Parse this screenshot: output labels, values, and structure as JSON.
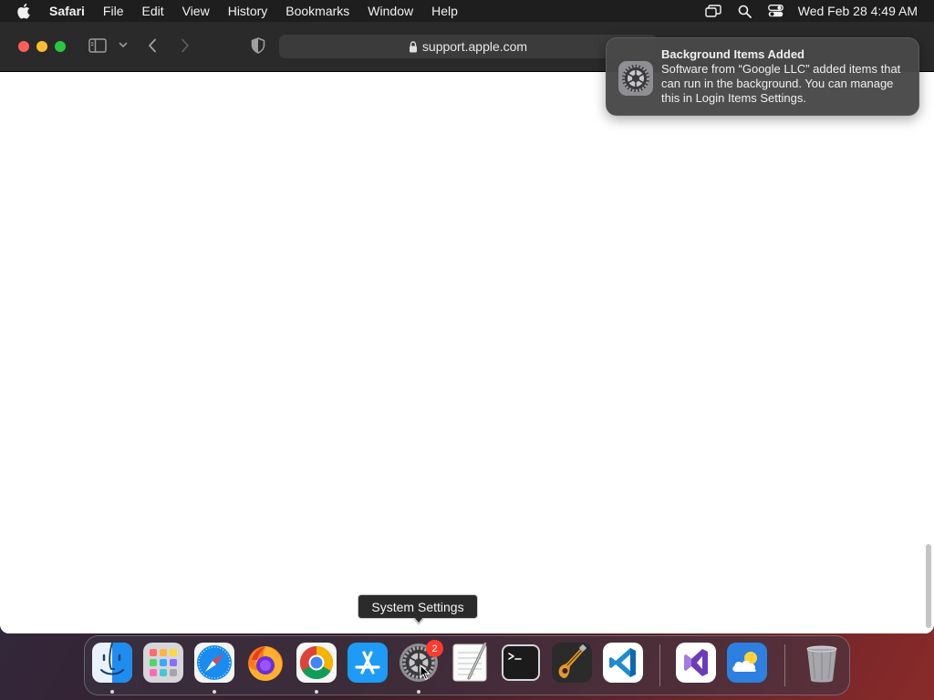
{
  "menubar": {
    "app_name": "Safari",
    "items": [
      "File",
      "Edit",
      "View",
      "History",
      "Bookmarks",
      "Window",
      "Help"
    ],
    "clock": "Wed Feb 28  4:49 AM",
    "status_icons": [
      "screen-mirroring-icon",
      "spotlight-search-icon",
      "control-center-icon"
    ]
  },
  "browser": {
    "url": "support.apple.com"
  },
  "notification": {
    "title": "Background Items Added",
    "body": "Software from “Google LLC” added items that can run in the background. You can manage this in Login Items Settings."
  },
  "tooltip": {
    "label": "System Settings"
  },
  "dock": {
    "items": [
      {
        "name": "Finder",
        "icon": "finder-icon",
        "running": true
      },
      {
        "name": "Launchpad",
        "icon": "launchpad-icon",
        "running": false
      },
      {
        "name": "Safari",
        "icon": "safari-icon",
        "running": true
      },
      {
        "name": "Firefox",
        "icon": "firefox-icon",
        "running": false
      },
      {
        "name": "Google Chrome",
        "icon": "chrome-icon",
        "running": true
      },
      {
        "name": "App Store",
        "icon": "app-store-icon",
        "running": false
      },
      {
        "name": "System Settings",
        "icon": "system-settings-icon",
        "running": true
      },
      {
        "name": "TextEdit",
        "icon": "textedit-icon",
        "running": false
      },
      {
        "name": "Terminal",
        "icon": "terminal-icon",
        "running": false
      },
      {
        "name": "GarageBand",
        "icon": "garageband-icon",
        "running": false
      },
      {
        "name": "Visual Studio Code",
        "icon": "vscode-icon",
        "running": false
      },
      {
        "name": "Visual Studio",
        "icon": "visual-studio-icon",
        "running": false
      },
      {
        "name": "Weather",
        "icon": "weather-icon",
        "running": false
      },
      {
        "name": "Trash",
        "icon": "trash-icon",
        "running": false
      }
    ],
    "system_settings_badge": "2"
  }
}
